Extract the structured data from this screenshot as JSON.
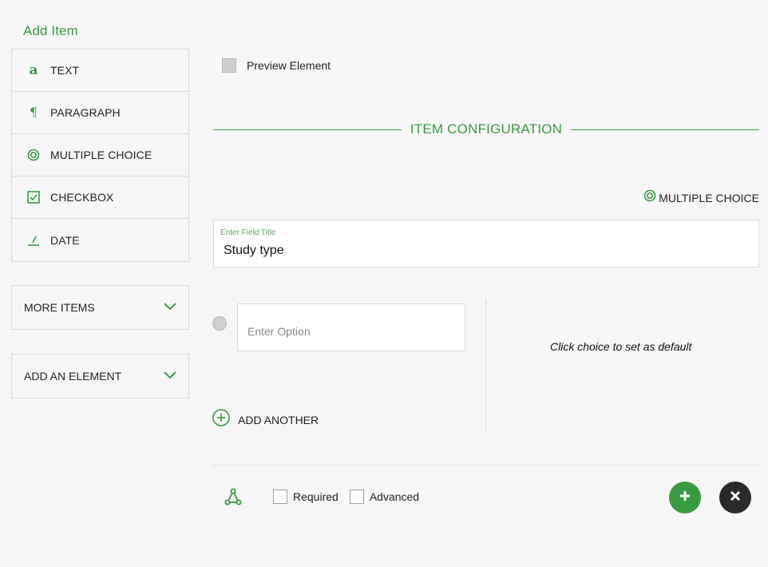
{
  "sidebar": {
    "title": "Add Item",
    "items": [
      {
        "label": "TEXT",
        "icon": "text-icon"
      },
      {
        "label": "PARAGRAPH",
        "icon": "paragraph-icon"
      },
      {
        "label": "MULTIPLE CHOICE",
        "icon": "radio-target-icon"
      },
      {
        "label": "CHECKBOX",
        "icon": "checkbox-icon"
      },
      {
        "label": "DATE",
        "icon": "pen-slash-icon"
      }
    ],
    "more_items_label": "MORE ITEMS",
    "add_element_label": "ADD AN ELEMENT"
  },
  "main": {
    "preview_label": "Preview Element",
    "section_heading": "ITEM CONFIGURATION",
    "type_badge_label": "MULTIPLE CHOICE",
    "title_field": {
      "floating_label": "Enter Field Title",
      "value": "Study type"
    },
    "option_placeholder": "Enter Option",
    "default_hint": "Click choice to set as default",
    "add_another_label": "ADD ANOTHER",
    "footer": {
      "required_label": "Required",
      "advanced_label": "Advanced"
    }
  },
  "colors": {
    "accent": "#3a9a3f",
    "dark_button": "#2a2a2c",
    "background": "#f7f7f9"
  }
}
